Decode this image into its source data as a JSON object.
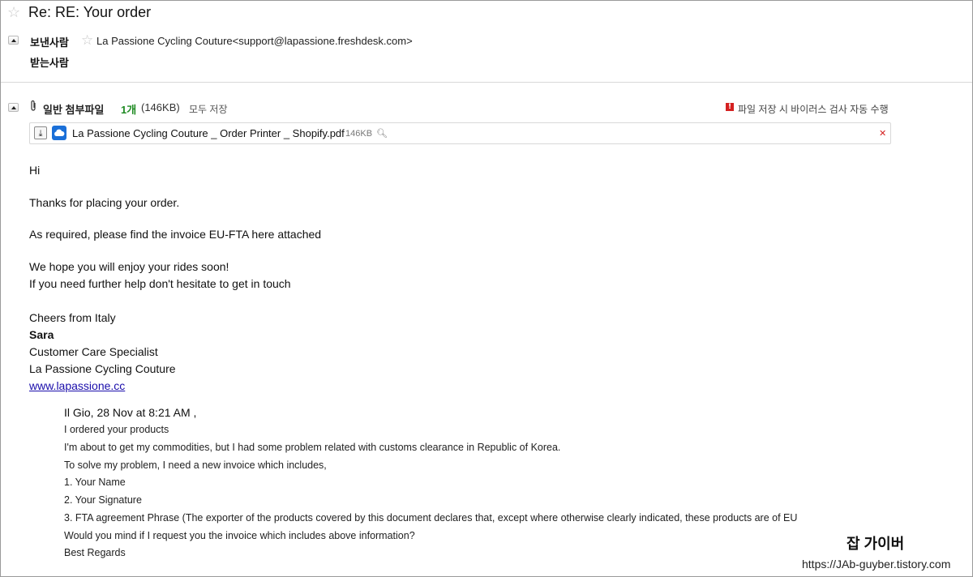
{
  "header": {
    "subject": "Re: RE: Your order",
    "from_label": "보낸사람",
    "from_value": "La Passione Cycling Couture<support@lapassione.freshdesk.com>",
    "to_label": "받는사람"
  },
  "attachments": {
    "title": "일반 첨부파일",
    "count": "1개",
    "total_size": "(146KB)",
    "save_all": "모두 저장",
    "virus_notice": "파일 저장 시 바이러스 검사 자동 수행",
    "file": {
      "name": "La Passione Cycling Couture _ Order Printer _ Shopify.pdf",
      "size": "146KB"
    }
  },
  "body": {
    "greeting": "Hi",
    "line1": "Thanks for placing your order.",
    "line2": "As required, please find the invoice EU-FTA here attached",
    "line3": "We hope you will enjoy your rides soon!",
    "line4": "If you need further help don't hesitate to get in touch",
    "sig_cheers": "Cheers from Italy",
    "sig_name": "Sara",
    "sig_title": "Customer Care Specialist",
    "sig_company": "La Passione Cycling Couture",
    "sig_link": "www.lapassione.cc"
  },
  "quoted": {
    "header": "Il Gio, 28 Nov at 8:21 AM ,",
    "lines": [
      "I ordered your products",
      "I'm about to get my commodities, but I had some problem related with customs clearance in Republic of Korea.",
      "To solve my problem, I need a new invoice which includes,",
      "1. Your Name",
      "2. Your Signature",
      "3. FTA agreement Phrase (The exporter of the products covered by this document declares that, except where otherwise clearly indicated, these products are of EU",
      "Would you mind if I request you the invoice which includes above information?",
      "Best Regards"
    ]
  },
  "watermark": {
    "title": "잡 가이버",
    "url": "https://JAb-guyber.tistory.com"
  },
  "colors": {
    "count_green": "#1e8a22",
    "warn_red": "#d42020",
    "cloud_blue": "#1a6fd8",
    "link_blue": "#1a0dab"
  }
}
